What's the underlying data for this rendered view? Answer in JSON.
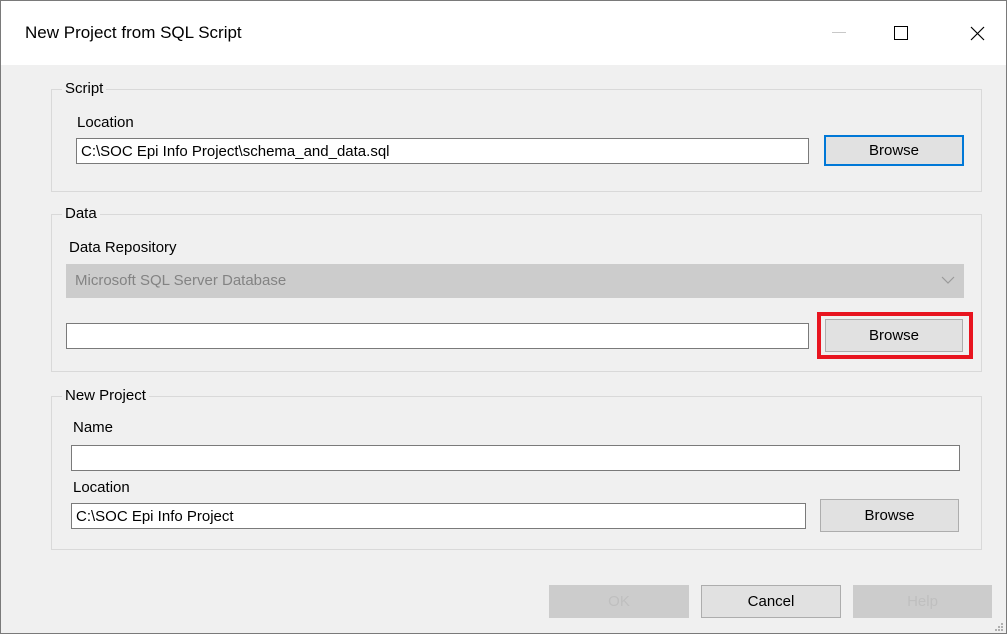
{
  "window": {
    "title": "New Project from SQL Script"
  },
  "script_group": {
    "legend": "Script",
    "location_label": "Location",
    "location_value": "C:\\SOC Epi Info Project\\schema_and_data.sql",
    "browse_label": "Browse"
  },
  "data_group": {
    "legend": "Data",
    "repository_label": "Data Repository",
    "repository_selected": "Microsoft SQL Server Database",
    "connection_value": "",
    "browse_label": "Browse"
  },
  "project_group": {
    "legend": "New Project",
    "name_label": "Name",
    "name_value": "",
    "location_label": "Location",
    "location_value": "C:\\SOC Epi Info Project",
    "browse_label": "Browse"
  },
  "footer": {
    "ok_label": "OK",
    "cancel_label": "Cancel",
    "help_label": "Help"
  },
  "colors": {
    "highlight": "#e8141f",
    "default_button_border": "#0078d7",
    "disabled_fill": "#cccccc"
  }
}
